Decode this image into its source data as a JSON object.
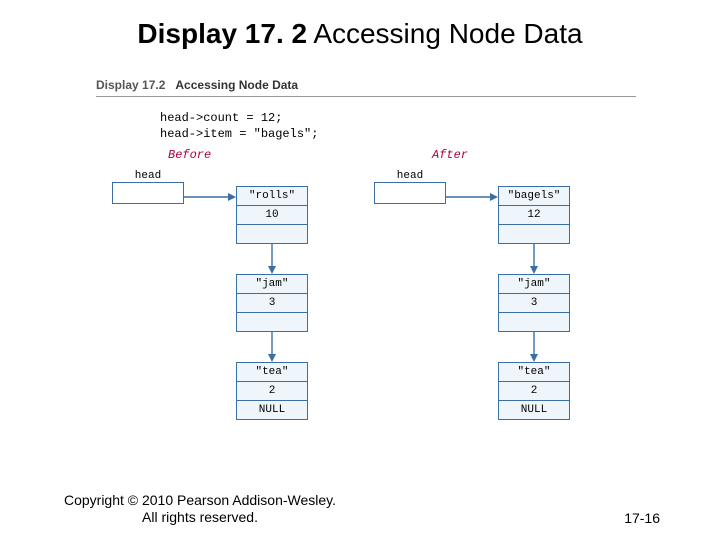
{
  "title": {
    "bold": "Display 17. 2",
    "rest": "  Accessing Node Data"
  },
  "panel": {
    "display_id": "Display 17.2",
    "caption": "Accessing Node Data",
    "code_lines": [
      "head->count = 12;",
      "head->item  = \"bagels\";"
    ],
    "before_label": "Before",
    "after_label": "After",
    "head_label": "head",
    "before_nodes": [
      {
        "item": "\"rolls\"",
        "count": "10"
      },
      {
        "item": "\"jam\"",
        "count": "3"
      },
      {
        "item": "\"tea\"",
        "count": "2",
        "link": "NULL"
      }
    ],
    "after_nodes": [
      {
        "item": "\"bagels\"",
        "count": "12"
      },
      {
        "item": "\"jam\"",
        "count": "3"
      },
      {
        "item": "\"tea\"",
        "count": "2",
        "link": "NULL"
      }
    ]
  },
  "footer": {
    "copyright": "Copyright © 2010 Pearson Addison-Wesley. All rights reserved.",
    "page": "17-16"
  }
}
